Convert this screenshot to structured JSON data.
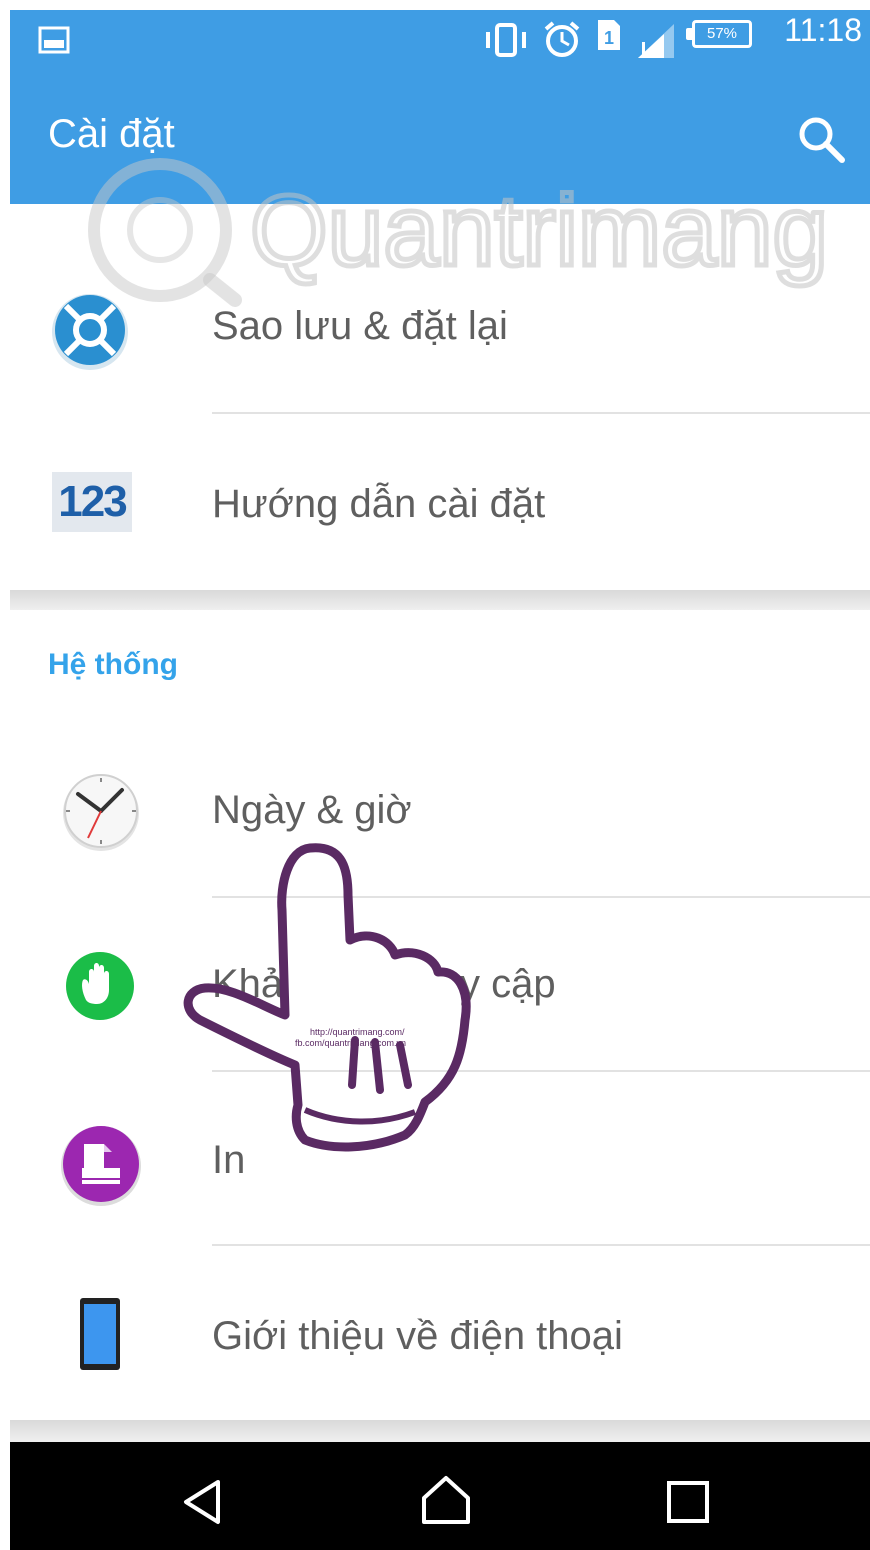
{
  "status_bar": {
    "time": "11:18",
    "battery": "57%",
    "icons": [
      "image-notification-icon",
      "vibrate-icon",
      "alarm-icon",
      "sim-1-icon",
      "signal-icon",
      "battery-icon"
    ]
  },
  "app_bar": {
    "title": "Cài đặt",
    "search_icon": "search-icon"
  },
  "list": {
    "items_top": [
      {
        "label": "Sao lưu & đặt lại",
        "icon": "backup-reset-icon"
      },
      {
        "label": "Hướng dẫn cài đặt",
        "icon": "setup-guide-icon",
        "icon_text": "123"
      }
    ],
    "section_header": "Hệ thống",
    "items_system": [
      {
        "label": "Ngày & giờ",
        "icon": "clock-icon"
      },
      {
        "label": "Khả năng truy cập",
        "visible_label_left": "Khả",
        "visible_label_right": "y cập",
        "icon": "accessibility-hand-icon"
      },
      {
        "label": "In",
        "icon": "print-icon"
      },
      {
        "label": "Giới thiệu về điện thoại",
        "icon": "phone-icon"
      }
    ]
  },
  "nav_bar": {
    "back": "back-icon",
    "home": "home-icon",
    "recents": "recents-icon"
  },
  "overlay": {
    "watermark": "Quantrimang",
    "hand_text_line1": "http://quantrimang.com/",
    "hand_text_line2": "fb.com/quantrimang.com.vn"
  },
  "colors": {
    "accent": "#3f9de4",
    "section_header": "#34a3ea",
    "label": "#5f5f5f",
    "hand_outline": "#5a2a63"
  }
}
